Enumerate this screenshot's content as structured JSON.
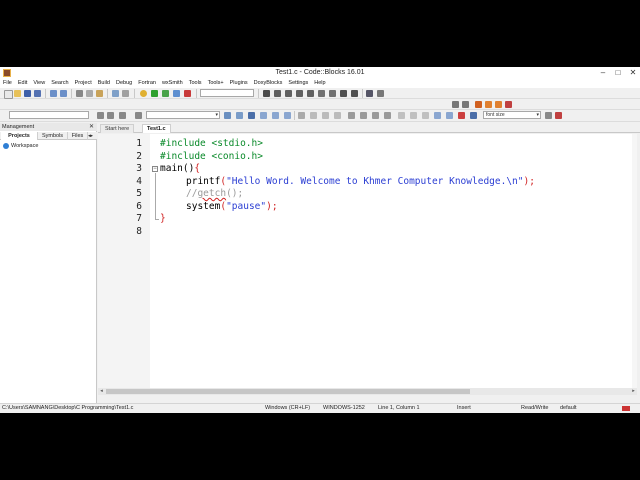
{
  "window": {
    "title": "Test1.c - Code::Blocks 16.01",
    "controls": {
      "minimize": "–",
      "maximize": "□",
      "close": "✕"
    }
  },
  "menubar": [
    "File",
    "Edit",
    "View",
    "Search",
    "Project",
    "Build",
    "Debug",
    "Fortran",
    "wxSmith",
    "Tools",
    "Tools+",
    "Plugins",
    "DoxyBlocks",
    "Settings",
    "Help"
  ],
  "toolbar": {
    "font_combo_value": "font size",
    "icons": [
      "new-file",
      "open",
      "save",
      "save-all",
      "undo",
      "redo",
      "cut",
      "copy",
      "paste",
      "find",
      "replace",
      "build",
      "run",
      "build-and-run",
      "rebuild",
      "abort",
      "debug",
      "step",
      "break",
      "stop",
      "jump-back",
      "jump-forward",
      "bookmark",
      "zoom-in",
      "zoom-out"
    ]
  },
  "management": {
    "title": "Management",
    "tabs": [
      "Projects",
      "Symbols",
      "Files"
    ],
    "active_tab": "Projects",
    "tree": [
      {
        "label": "Workspace",
        "icon": "workspace-icon"
      }
    ]
  },
  "editor": {
    "tabs": [
      {
        "label": "Start here",
        "active": false
      },
      {
        "label": "Test1.c",
        "active": true
      }
    ],
    "lines": [
      {
        "n": "1",
        "text": "#include <stdio.h>"
      },
      {
        "n": "2",
        "text": "#include <conio.h>"
      },
      {
        "n": "3",
        "text": "main(){"
      },
      {
        "n": "4",
        "text": "printf(\"Hello Word. Welcome to Khmer Computer Knowledge.\\n\");"
      },
      {
        "n": "5",
        "text": "//getch();"
      },
      {
        "n": "6",
        "text": "system(\"pause\");"
      },
      {
        "n": "7",
        "text": "}"
      },
      {
        "n": "8",
        "text": ""
      }
    ],
    "code_parts": {
      "l1": "#include <stdio.h>",
      "l2": "#include <conio.h>",
      "l3a": "main()",
      "l3b": "{",
      "l4a": "printf",
      "l4b": "(",
      "l4c": "\"Hello Word. Welcome to Khmer Computer Knowledge.\\n\"",
      "l4d": ");",
      "l5a": "//",
      "l5b": "getch",
      "l5c": "();",
      "l6a": "system",
      "l6b": "(",
      "l6c": "\"pause\"",
      "l6d": ");",
      "l7": "}"
    },
    "colors": {
      "preprocessor": "#0a8a2a",
      "string": "#2b3ed3",
      "operator": "#d02020",
      "comment": "#9a9a9a"
    }
  },
  "statusbar": {
    "path": "C:\\Users\\SAMNANG\\Desktop\\C Programming\\Test1.c",
    "eol": "Windows (CR+LF)",
    "encoding": "WINDOWS-1252",
    "position": "Line 1, Column 1",
    "mode": "Insert",
    "access": "Read/Write",
    "profile": "default"
  }
}
